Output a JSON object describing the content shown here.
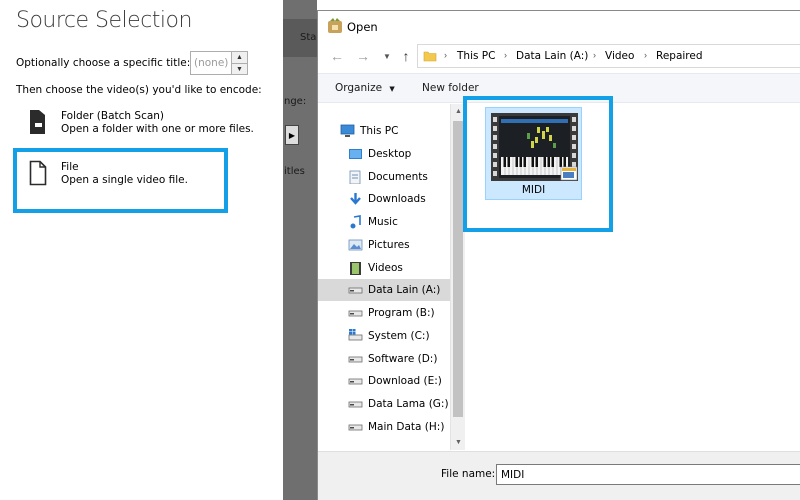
{
  "source": {
    "title": "Source Selection",
    "title_prompt": "Optionally choose a specific title:",
    "title_select_value": "(none)",
    "choose_prompt": "Then choose the video(s) you'd like to encode:",
    "options": [
      {
        "title": "Folder (Batch Scan)",
        "description": "Open a folder with one or more files."
      },
      {
        "title": "File",
        "description": "Open a single video file."
      }
    ],
    "highlight_color": "#14a0e6"
  },
  "background_app": {
    "fragments": [
      "Sta",
      "nge:",
      "itles"
    ]
  },
  "dialog": {
    "title": "Open",
    "breadcrumbs": [
      "This PC",
      "Data Lain (A:)",
      "Video",
      "Repaired"
    ],
    "toolbar": {
      "organize": "Organize",
      "new_folder": "New folder"
    },
    "nav_items": [
      {
        "label": "This PC",
        "icon": "computer-icon"
      },
      {
        "label": "Desktop",
        "icon": "desktop-icon"
      },
      {
        "label": "Documents",
        "icon": "documents-icon"
      },
      {
        "label": "Downloads",
        "icon": "downloads-icon"
      },
      {
        "label": "Music",
        "icon": "music-icon"
      },
      {
        "label": "Pictures",
        "icon": "pictures-icon"
      },
      {
        "label": "Videos",
        "icon": "videos-icon"
      },
      {
        "label": "Data Lain (A:)",
        "icon": "drive-icon",
        "selected": true
      },
      {
        "label": "Program (B:)",
        "icon": "drive-icon"
      },
      {
        "label": "System (C:)",
        "icon": "system-drive-icon"
      },
      {
        "label": "Software (D:)",
        "icon": "drive-icon"
      },
      {
        "label": "Download (E:)",
        "icon": "drive-icon"
      },
      {
        "label": "Data Lama (G:)",
        "icon": "drive-icon"
      },
      {
        "label": "Main Data (H:)",
        "icon": "drive-icon"
      }
    ],
    "files": [
      {
        "name": "MIDI",
        "icon": "video-file-thumbnail-icon",
        "selected": true
      }
    ],
    "file_name_label": "File name:",
    "file_name_value": "MIDI"
  }
}
